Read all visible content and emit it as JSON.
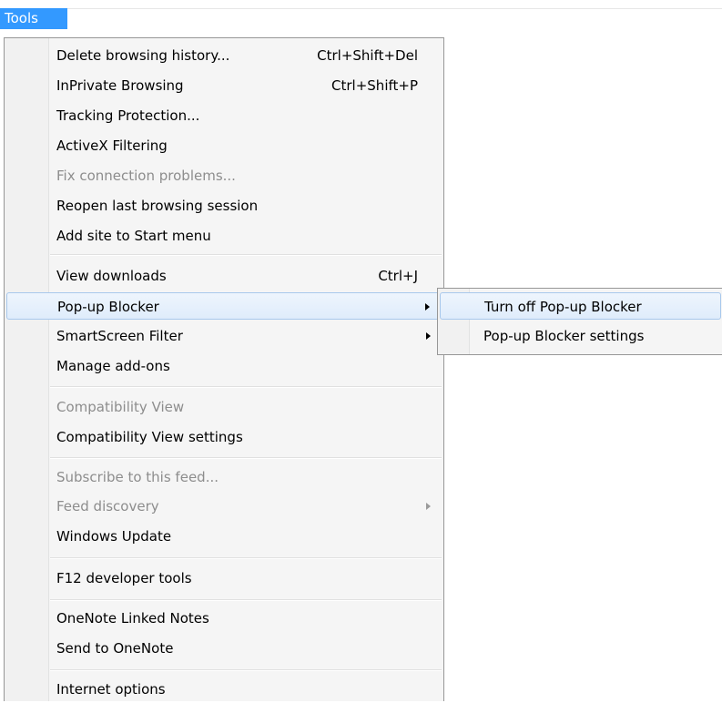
{
  "menubar": {
    "tools_label": "Tools"
  },
  "menu": {
    "items": [
      {
        "label": "Delete browsing history...",
        "shortcut": "Ctrl+Shift+Del"
      },
      {
        "label": "InPrivate Browsing",
        "shortcut": "Ctrl+Shift+P"
      },
      {
        "label": "Tracking Protection..."
      },
      {
        "label": "ActiveX Filtering"
      },
      {
        "label": "Fix connection problems...",
        "disabled": true
      },
      {
        "label": "Reopen last browsing session"
      },
      {
        "label": "Add site to Start menu"
      },
      {
        "label": "View downloads",
        "shortcut": "Ctrl+J"
      },
      {
        "label": "Pop-up Blocker",
        "submenu": true,
        "highlighted": true
      },
      {
        "label": "SmartScreen Filter",
        "submenu": true
      },
      {
        "label": "Manage add-ons"
      },
      {
        "label": "Compatibility View",
        "disabled": true
      },
      {
        "label": "Compatibility View settings"
      },
      {
        "label": "Subscribe to this feed...",
        "disabled": true
      },
      {
        "label": "Feed discovery",
        "disabled": true,
        "submenu": true
      },
      {
        "label": "Windows Update"
      },
      {
        "label": "F12 developer tools"
      },
      {
        "label": "OneNote Linked Notes"
      },
      {
        "label": "Send to OneNote"
      },
      {
        "label": "Internet options"
      }
    ]
  },
  "submenu": {
    "items": [
      {
        "label": "Turn off Pop-up Blocker",
        "highlighted": true
      },
      {
        "label": "Pop-up Blocker settings"
      }
    ]
  },
  "colors": {
    "menubar_highlight": "#3399ff",
    "item_highlight_border": "#a8c8ec",
    "disabled_text": "#8d8d8d"
  }
}
